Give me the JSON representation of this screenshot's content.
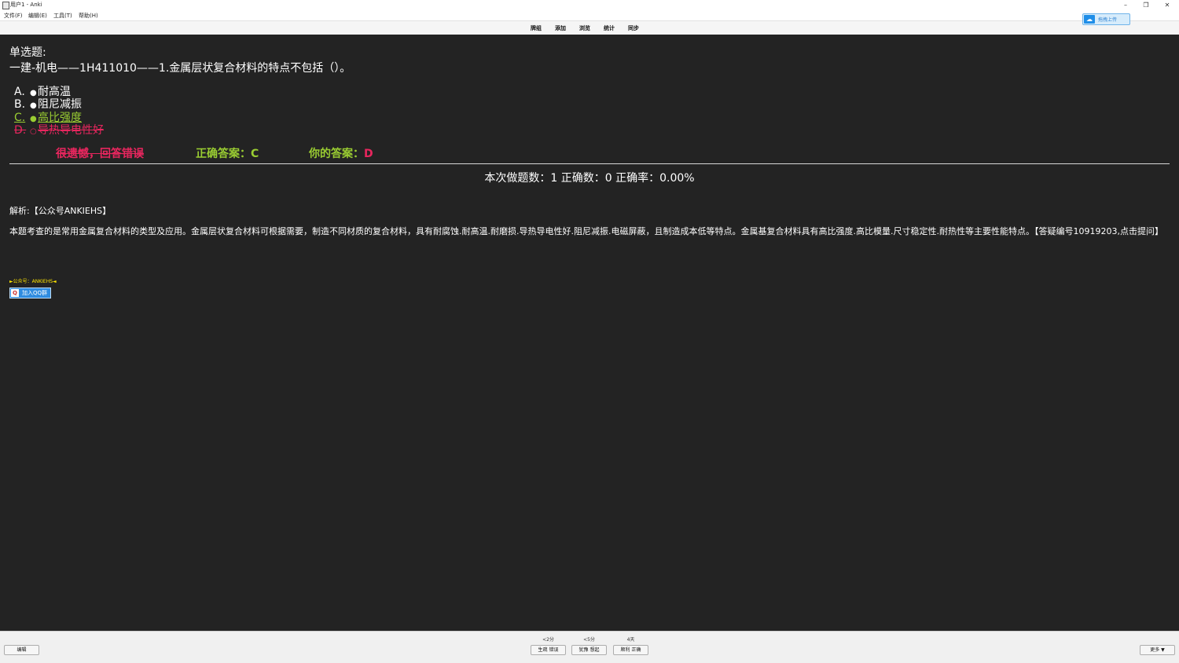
{
  "window": {
    "title": "用户1 - Anki"
  },
  "menu": [
    "文件(F)",
    "编辑(E)",
    "工具(T)",
    "帮助(H)"
  ],
  "toolbar": [
    "牌组",
    "添加",
    "浏览",
    "统计",
    "同步"
  ],
  "upload_badge": {
    "label": "拖拽上传"
  },
  "question": {
    "type": "单选题:",
    "text": "一建-机电——1H411010——1.金属层状复合材料的特点不包括（）。",
    "options": [
      {
        "letter": "A.",
        "text": "耐高温",
        "state": "normal"
      },
      {
        "letter": "B.",
        "text": "阻尼减振",
        "state": "normal"
      },
      {
        "letter": "C.",
        "text": "高比强度",
        "state": "correct"
      },
      {
        "letter": "D.",
        "text": "导热导电性好",
        "state": "wrong"
      }
    ]
  },
  "result": {
    "verdict": "很遗憾，回答错误",
    "correct_answer": "正确答案：C",
    "your_answer": "你的答案：D"
  },
  "stats": {
    "text": "本次做题数：1 正确数：0 正确率：0.00%"
  },
  "analysis": {
    "head": "解析:【公众号ANKIEHS】",
    "body": "本题考查的是常用金属复合材料的类型及应用。金属层状复合材料可根据需要，制造不同材质的复合材料，具有耐腐蚀.耐高温.耐磨损.导热导电性好.阻尼减振.电磁屏蔽，且制造成本低等特点。金属基复合材料具有高比强度.高比模量.尺寸稳定性.耐热性等主要性能特点。【答疑编号10919203,点击提问】"
  },
  "promo": {
    "text": "►公众号：ANKIEHS◄"
  },
  "qq_button": {
    "label": "加入QQ群"
  },
  "bottom": {
    "edit_label": "编辑",
    "intervals": [
      "<2分",
      "<5分",
      "4天"
    ],
    "answers": [
      "生疏 错误",
      "犹豫 想起",
      "顺利 正确"
    ],
    "more_label": "更多 ▼"
  },
  "colors": {
    "correct": "#9acd32",
    "wrong": "#e8265e",
    "content_bg": "#232323",
    "promo": "#ffe600"
  }
}
